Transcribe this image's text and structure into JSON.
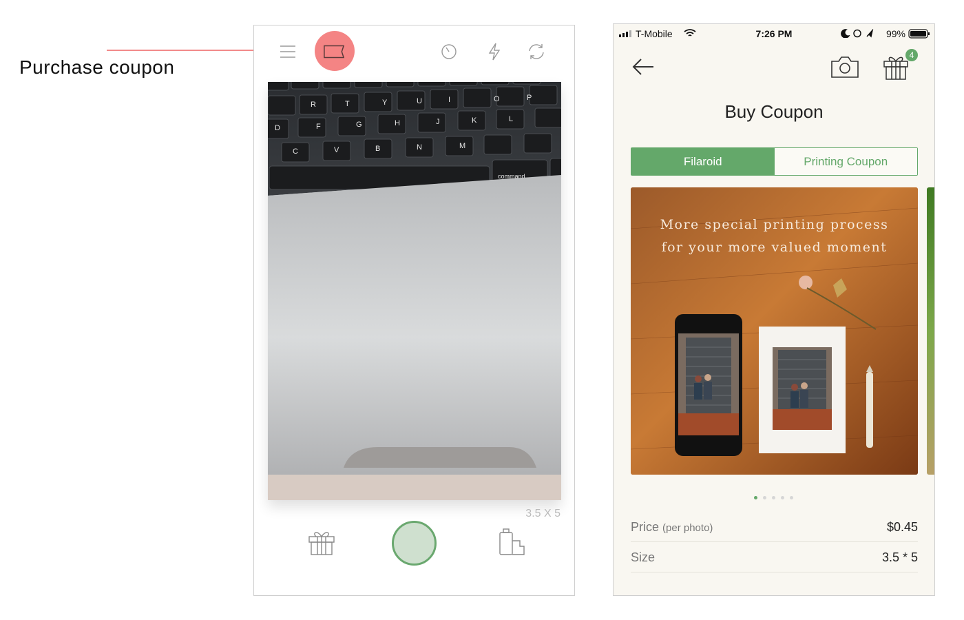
{
  "annotation": {
    "label": "Purchase coupon",
    "line_color": "#f28a8a"
  },
  "left_phone": {
    "top_icons": [
      "menu-icon",
      "coupon-icon",
      "timer-icon",
      "flash-icon",
      "switch-camera-icon"
    ],
    "photo_size_label": "3.5 X 5",
    "bottom_icons": [
      "gift-icon",
      "shutter-button",
      "film-pack-icon"
    ]
  },
  "right_phone": {
    "status_bar": {
      "carrier": "T-Mobile",
      "time": "7:26 PM",
      "battery": "99%"
    },
    "gift_badge_count": "4",
    "title": "Buy Coupon",
    "tabs": [
      {
        "label": "Filaroid",
        "active": true
      },
      {
        "label": "Printing Coupon",
        "active": false
      }
    ],
    "banner": {
      "line1": "More special printing process",
      "line2": "for your more valued moment"
    },
    "carousel_pages": 5,
    "carousel_active": 1,
    "details": {
      "price_label": "Price",
      "price_sub": "(per photo)",
      "price_value": "$0.45",
      "size_label": "Size",
      "size_value": "3.5 * 5"
    }
  },
  "colors": {
    "accent": "#64a86a",
    "highlight": "#f48484"
  }
}
